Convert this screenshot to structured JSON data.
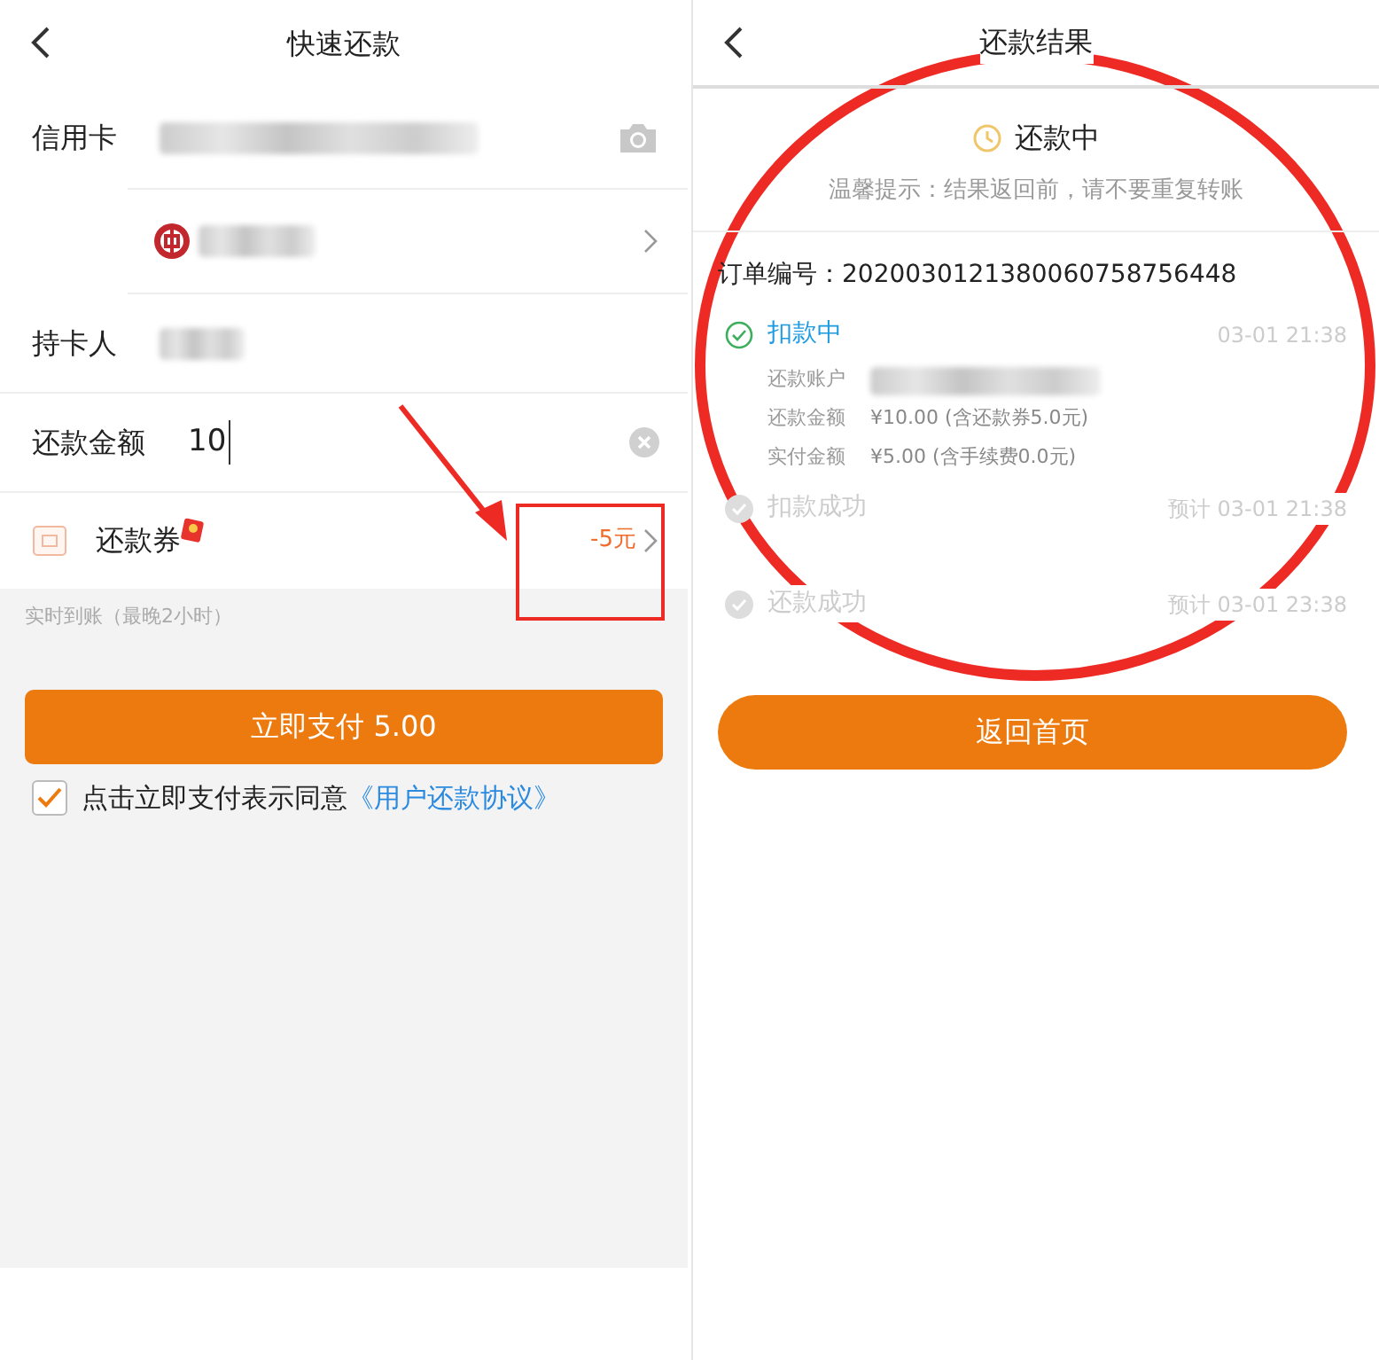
{
  "left_screen": {
    "title": "快速还款",
    "fields": [
      {
        "kind": "card",
        "label": "信用卡"
      },
      {
        "kind": "bank"
      },
      {
        "kind": "holder",
        "label": "持卡人"
      },
      {
        "kind": "amount",
        "label": "还款金额",
        "value": "10"
      }
    ],
    "coupon": {
      "label": "还款券",
      "value": "-5元"
    },
    "hint": "实时到账（最晚2小时）",
    "pay_button": "立即支付 5.00",
    "agreement": {
      "checked": true,
      "text": "点击立即支付表示同意",
      "link": "《用户还款协议》"
    }
  },
  "right_screen": {
    "title": "还款结果",
    "status": "还款中",
    "tip": "温馨提示：结果返回前，请不要重复转账",
    "order": "订单编号：2020030121380060758756448",
    "steps": [
      {
        "label": "扣款中",
        "time": "03-01 21:38",
        "active": true,
        "details": [
          {
            "label": "还款账户"
          },
          {
            "label": "还款金额",
            "value": "¥10.00 (含还款券5.0元)"
          },
          {
            "label": "实付金额",
            "value": "¥5.00 (含手续费0.0元)"
          }
        ]
      },
      {
        "label": "扣款成功",
        "time": "预计 03-01 21:38",
        "active": false
      },
      {
        "label": "还款成功",
        "time": "预计 03-01 23:38",
        "active": false
      }
    ],
    "button": "返回首页"
  },
  "annotations": [
    {
      "kind": "arrow"
    },
    {
      "kind": "rectangle"
    },
    {
      "kind": "ellipse"
    }
  ]
}
